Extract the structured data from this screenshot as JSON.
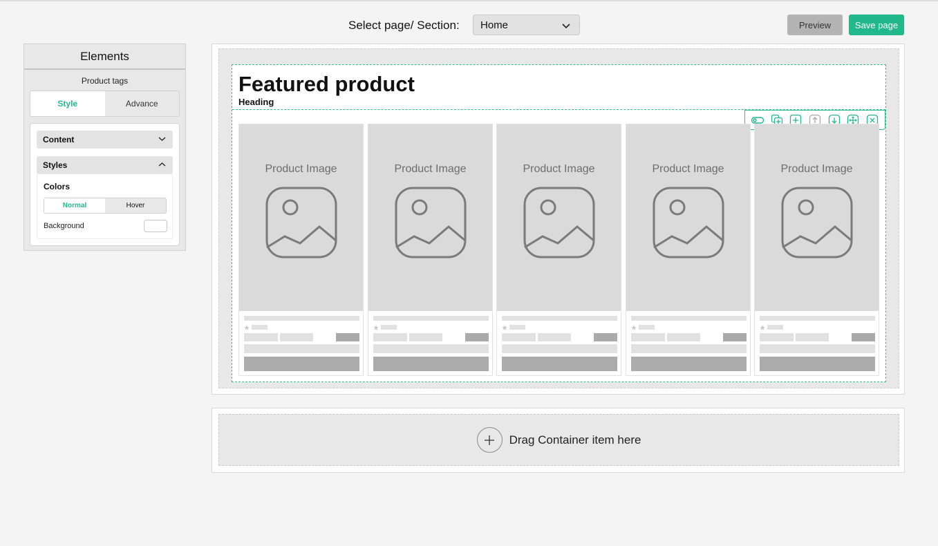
{
  "topbar": {
    "select_label": "Select page/ Section:",
    "select_value": "Home",
    "preview_label": "Preview",
    "save_label": "Save page"
  },
  "panel": {
    "title": "Elements",
    "subtitle": "Product tags",
    "tabs": [
      "Style",
      "Advance"
    ],
    "active_tab": "Style",
    "accordion_content": "Content",
    "accordion_styles": "Styles",
    "colors_label": "Colors",
    "state_tabs": [
      "Normal",
      "Hover"
    ],
    "active_state": "Normal",
    "background_label": "Background",
    "background_value": "#ffffff"
  },
  "section": {
    "heading": "Featured product",
    "heading_caption": "Heading",
    "toolbar_icons": [
      "toggle-icon",
      "duplicate-icon",
      "add-icon",
      "move-up-icon",
      "move-down-icon",
      "drag-move-icon",
      "delete-icon"
    ]
  },
  "products": [
    {
      "image_label": "Product Image"
    },
    {
      "image_label": "Product Image"
    },
    {
      "image_label": "Product Image"
    },
    {
      "image_label": "Product Image"
    },
    {
      "image_label": "Product Image"
    }
  ],
  "dropzone": {
    "label": "Drag Container item here"
  },
  "colors": {
    "accent": "#21b88c",
    "preview_button": "#b3b3b3",
    "placeholder": "#dadada"
  }
}
